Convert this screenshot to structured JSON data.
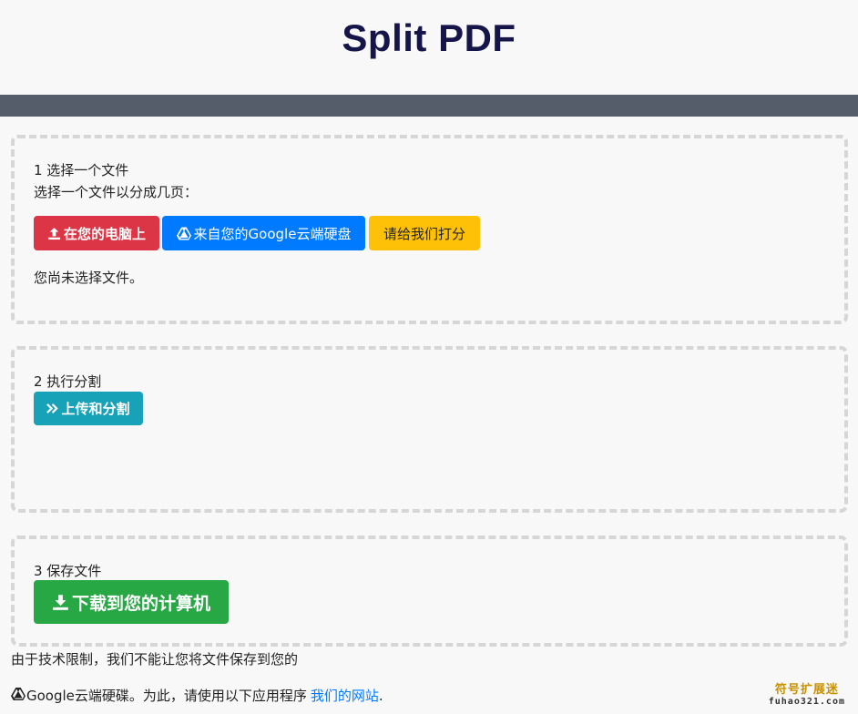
{
  "header": {
    "title": "Split PDF"
  },
  "step1": {
    "heading": "1 选择一个文件",
    "instruction": "选择一个文件以分成几页：",
    "buttons": {
      "from_computer": "在您的电脑上",
      "from_drive": "来自您的Google云端硬盘",
      "rate_us": "请给我们打分"
    },
    "status": "您尚未选择文件。"
  },
  "step2": {
    "heading": "2 执行分割",
    "button": "上传和分割"
  },
  "step3": {
    "heading": "3 保存文件",
    "button": "下载到您的计算机"
  },
  "footer": {
    "line1": "由于技术限制，我们不能让您将文件保存到您的",
    "line2_prefix": "Google云端硬碟。为此，请使用以下应用程序",
    "link": "我们的网站",
    "line2_suffix": "."
  },
  "watermark": {
    "top": "符号扩展迷",
    "bottom": "fuhao321.com"
  },
  "colors": {
    "title": "#15154a",
    "nav": "#555c6a",
    "red": "#dc3545",
    "blue": "#007bff",
    "yellow": "#ffc107",
    "teal": "#17a2b8",
    "green": "#28a745"
  },
  "icons": {
    "upload": "upload-icon",
    "drive": "google-drive-icon",
    "forward": "double-chevron-right-icon",
    "download": "download-icon"
  }
}
